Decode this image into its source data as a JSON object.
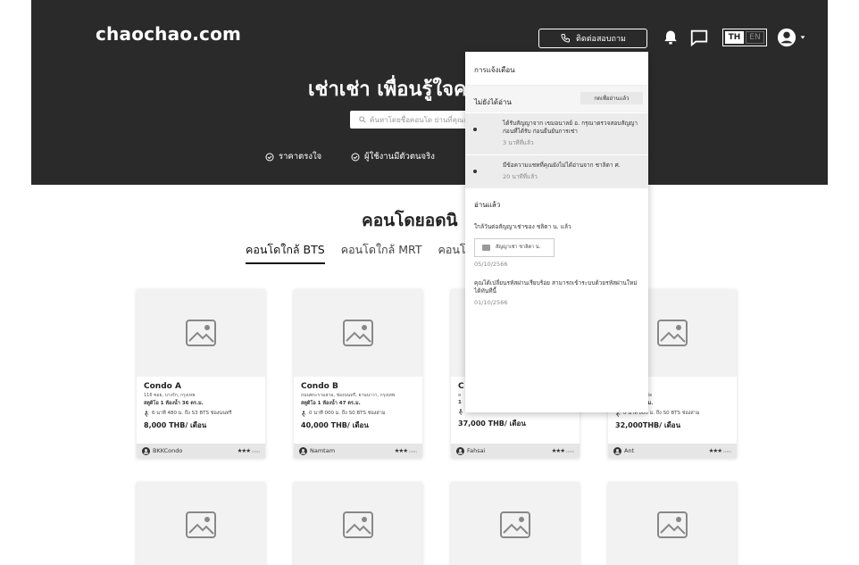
{
  "header": {
    "logo": "chaochao.com",
    "contact_label": "ติดต่อสอบถาม",
    "lang_active": "TH",
    "lang_inactive": "EN"
  },
  "hero": {
    "title": "เช่าเช่า เพื่อนรู้ใจค",
    "search_placeholder": "ค้นหาโดยชื่อคอนโด ย่านที่คุณสน",
    "features": [
      "ราคาตรงใจ",
      "ผู้ใช้งานมีตัวตนจริง"
    ]
  },
  "section": {
    "title": "คอนโดยอดนิ",
    "tabs": [
      "คอนโดใกล้ BTS",
      "คอนโดใกล้ MRT",
      "คอนโด"
    ]
  },
  "cards": [
    {
      "name": "Condo A",
      "address": "116 ซอย, บางรัก, กรุงเทพ",
      "size": "สตูดิโอ 1 ห้องน้ำ 36 ตร.ม.",
      "transit": "6 นาที 480 ม. ถึง S3 BTS ช่องนนทรี",
      "price": "8,000 THB/ เดือน",
      "owner": "BKKCondo",
      "stars": "★★★",
      "reviews": "(xxx)"
    },
    {
      "name": "Condo B",
      "address": "ถนนพระรามสาม, ช่องนนทรี, ยานนาวา, กรุงเทพ",
      "size": "สตูดิโอ 1 ห้องน้ำ 47 ตร.ม.",
      "transit": "0 นาที 000 ม. ถึง S0 BTS ช่องสาม",
      "price": "40,000 THB/ เดือน",
      "owner": "Namtam",
      "stars": "★★★",
      "reviews": "(xxx)"
    },
    {
      "name": "C",
      "address": "ส",
      "size": "1",
      "transit": "0 นาที 000 ม. ถึง S0 BTS ช่องสาม",
      "price": "37,000 THB/ เดือน",
      "owner": "Fahsai",
      "stars": "★★★",
      "reviews": "(xxx)"
    },
    {
      "name": "D",
      "address": "แขวง, เขต, จังหวัด",
      "size": "ห้องน้ำ 79 ตร.ม.",
      "transit": "0 นาที 000 ม. ถึง S0 BTS ช่องสาม",
      "price": "32,000THB/ เดือน",
      "owner": "Ant",
      "stars": "★★★",
      "reviews": "(xxx)"
    }
  ],
  "notifications": {
    "title": "การแจ้งเตือน",
    "unread_label": "ไม่ยังได้อ่าน",
    "mark_all_read": "กดเพื่ออ่านแล้ว",
    "unread": [
      {
        "text": "ได้รับสัญญาจาก เขมอนาลย์ อ. กรุณาตรวจสอบสัญญาก่อนที่ได้รับ ก่อนยืนยันการเช่า",
        "time": "3 นาทีที่แล้ว"
      },
      {
        "text": "มีข้อความแชทที่คุณยังไม่ได้อ่านจาก ชาลิตา ศ.",
        "time": "20 นาทีที่แล้ว"
      }
    ],
    "read_label": "อ่านแล้ว",
    "read": [
      {
        "text": "ใกล้วันต่อสัญญาเช่าของ ชลิตา น. แล้ว",
        "attachment": "สัญญาเช่า ชาลิตา น.",
        "time": "05/10/2566"
      },
      {
        "text": "คุณได้เปลี่ยนรหัสผ่านเรียบร้อย สามารถเข้าระบบด้วยรหัสผ่านใหม่ได้ทันทีนี้",
        "time": "01/10/2566"
      }
    ]
  }
}
